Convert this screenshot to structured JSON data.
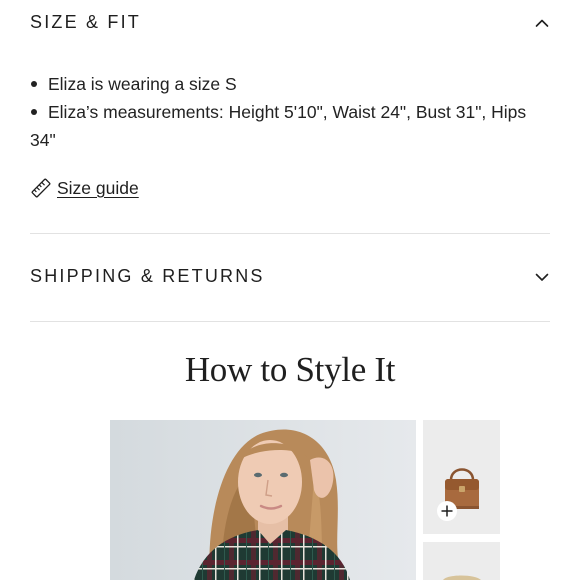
{
  "size_fit": {
    "title": "SIZE & FIT",
    "expanded": true,
    "bullets": [
      "Eliza is wearing a size S",
      "Eliza’s measurements: Height 5'10\", Waist 24\", Bust 31\", Hips",
      "34\""
    ],
    "size_guide_label": "Size guide"
  },
  "shipping": {
    "title": "SHIPPING & RETURNS",
    "expanded": false
  },
  "style_section": {
    "heading": "How to Style It"
  },
  "icons": {
    "collapse": "chevron-up-icon",
    "expand": "chevron-down-icon",
    "ruler": "ruler-icon",
    "add": "plus-icon"
  },
  "colors": {
    "text": "#1f1f1f",
    "divider": "#e2e2e2",
    "thumb_bg": "#ececec",
    "bag_brown": "#a86a3e"
  }
}
